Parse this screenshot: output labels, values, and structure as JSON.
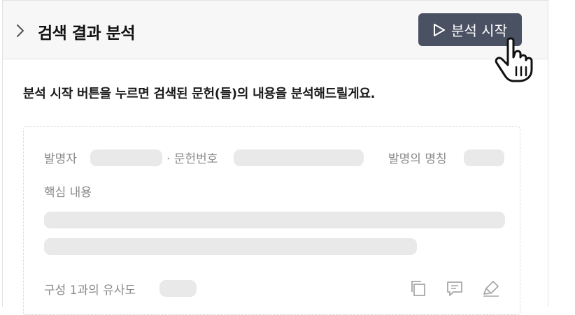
{
  "header": {
    "title": "검색 결과 분석",
    "start_button_label": "분석 시작"
  },
  "instruction": "분석 시작 버튼을 누르면 검색된 문헌(들)의 내용을 분석해드릴게요.",
  "card": {
    "inventor_label": "발명자",
    "doc_number_label": "· 문헌번호",
    "invention_title_label": "발명의 명칭",
    "core_content_label": "핵심 내용",
    "similarity_label": "구성 1과의 유사도"
  },
  "icons": [
    "chevron-right-icon",
    "play-icon",
    "hand-cursor-icon",
    "copy-icon",
    "comment-icon",
    "highlighter-icon"
  ]
}
